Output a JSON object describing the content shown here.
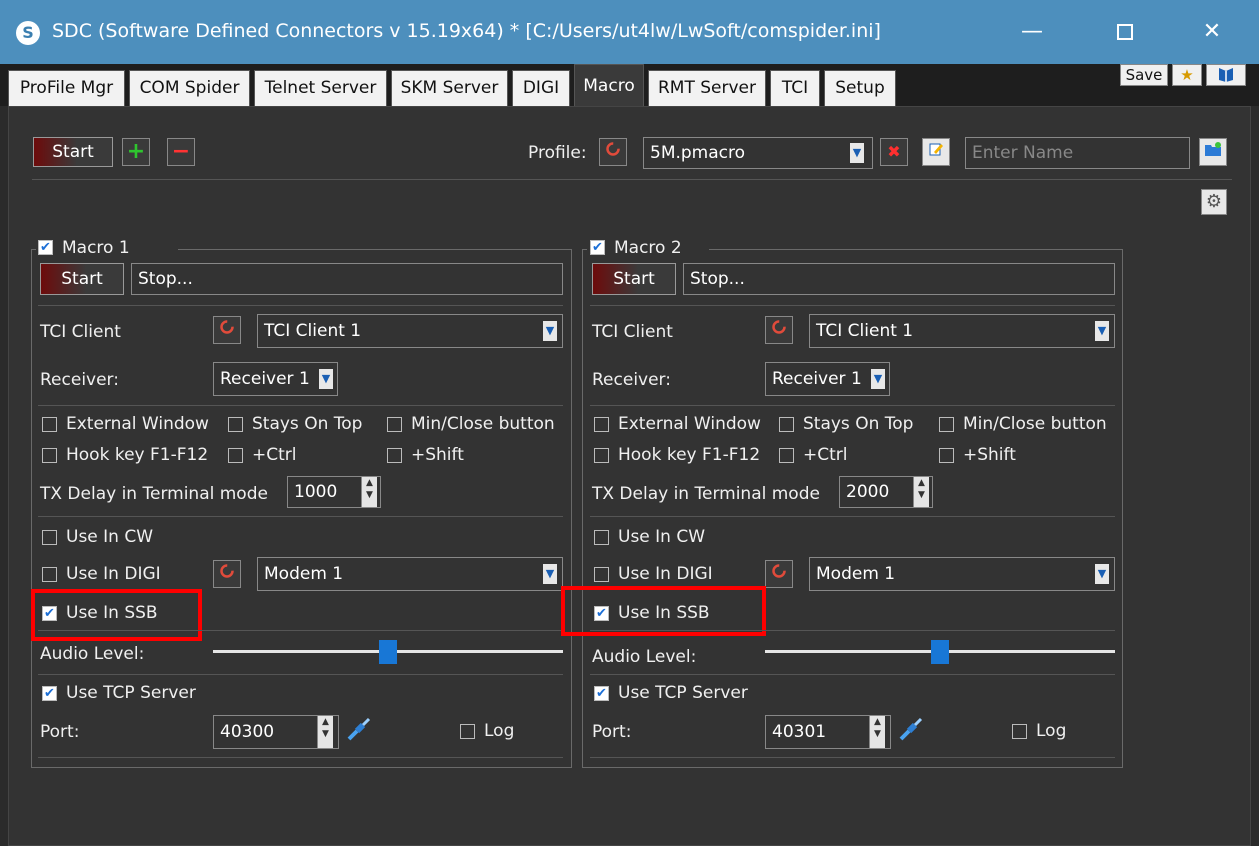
{
  "window": {
    "title": "SDC (Software Defined Connectors v 15.19x64) * [C:/Users/ut4lw/LwSoft/comspider.ini]",
    "app_icon": "S",
    "minimize": "—",
    "close": "✕"
  },
  "tabs": [
    "ProFile Mgr",
    "COM Spider",
    "Telnet Server",
    "SKM Server",
    "DIGI",
    "Macro",
    "RMT Server",
    "TCI",
    "Setup"
  ],
  "active_tab": "Macro",
  "top_buttons": {
    "save": "Save",
    "star": "★"
  },
  "toolbar": {
    "start": "Start",
    "add": "+",
    "remove": "−",
    "profile_label": "Profile:",
    "profile_value": "5M.pmacro",
    "name_placeholder": "Enter Name"
  },
  "macros": [
    {
      "title": "Macro 1",
      "enabled": true,
      "start": "Start",
      "stop_text": "Stop...",
      "tci_client_label": "TCI Client",
      "tci_client_value": "TCI Client 1",
      "receiver_label": "Receiver:",
      "receiver_value": "Receiver 1",
      "external_window": "External Window",
      "stays_on_top": "Stays On Top",
      "min_close": "Min/Close button",
      "hook_key": "Hook key F1-F12",
      "ctrl": "+Ctrl",
      "shift": "+Shift",
      "tx_delay_label": "TX Delay in Terminal mode",
      "tx_delay_value": "1000",
      "use_cw": "Use In CW",
      "use_cw_checked": false,
      "use_digi": "Use In DIGI",
      "use_digi_checked": false,
      "modem_value": "Modem 1",
      "use_ssb": "Use In SSB",
      "use_ssb_checked": true,
      "audio_level_label": "Audio Level:",
      "audio_level": 0.5,
      "use_tcp": "Use TCP Server",
      "use_tcp_checked": true,
      "port_label": "Port:",
      "port_value": "40300",
      "log": "Log"
    },
    {
      "title": "Macro 2",
      "enabled": true,
      "start": "Start",
      "stop_text": "Stop...",
      "tci_client_label": "TCI Client",
      "tci_client_value": "TCI Client 1",
      "receiver_label": "Receiver:",
      "receiver_value": "Receiver 1",
      "external_window": "External Window",
      "stays_on_top": "Stays On Top",
      "min_close": "Min/Close button",
      "hook_key": "Hook key F1-F12",
      "ctrl": "+Ctrl",
      "shift": "+Shift",
      "tx_delay_label": "TX Delay in Terminal mode",
      "tx_delay_value": "2000",
      "use_cw": "Use In CW",
      "use_cw_checked": false,
      "use_digi": "Use In DIGI",
      "use_digi_checked": false,
      "modem_value": "Modem 1",
      "use_ssb": "Use In SSB",
      "use_ssb_checked": true,
      "audio_level_label": "Audio Level:",
      "audio_level": 0.5,
      "use_tcp": "Use TCP Server",
      "use_tcp_checked": true,
      "port_label": "Port:",
      "port_value": "40301",
      "log": "Log"
    }
  ],
  "colors": {
    "titlebar": "#4d8fbd",
    "highlight": "#ff0000",
    "slider_thumb": "#1877d6"
  }
}
